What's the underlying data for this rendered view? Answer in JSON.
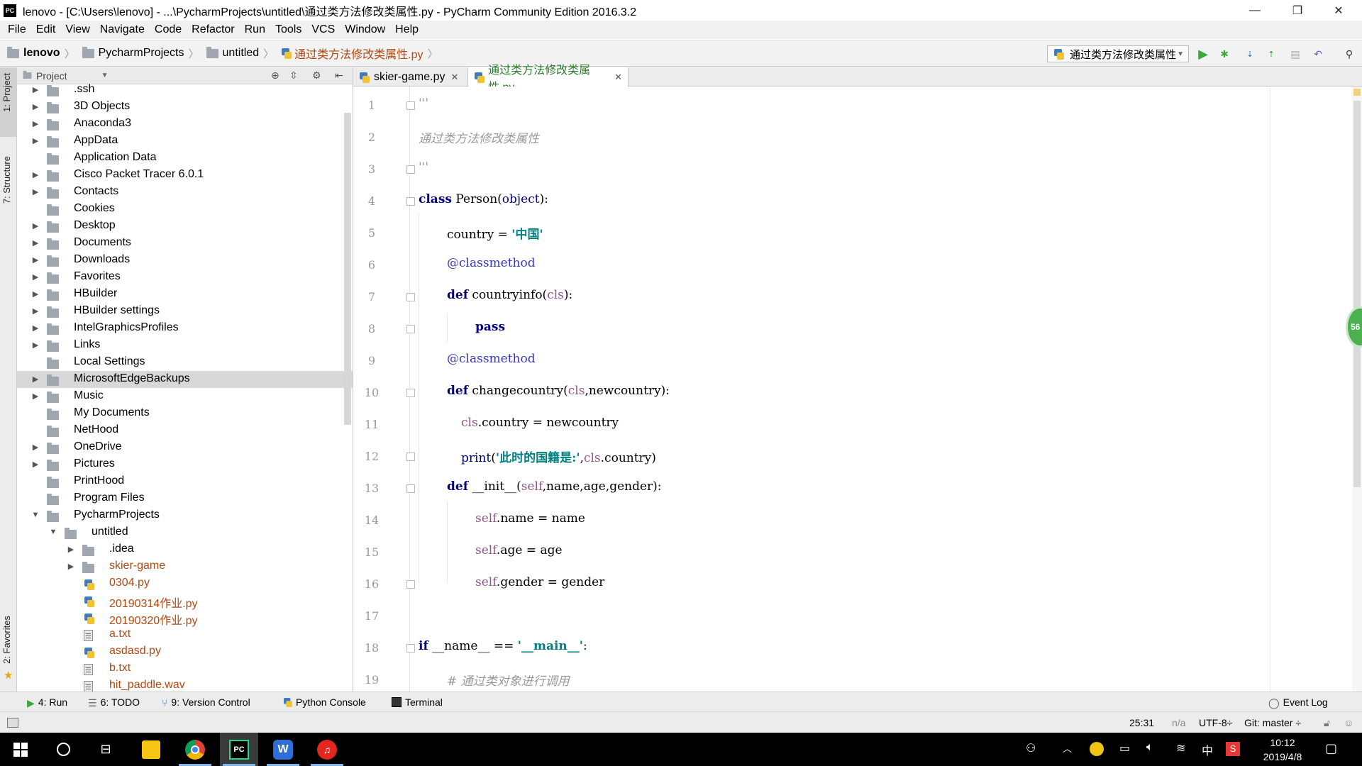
{
  "window": {
    "title": "lenovo - [C:\\Users\\lenovo] - ...\\PycharmProjects\\untitled\\通过类方法修改类属性.py - PyCharm Community Edition 2016.3.2",
    "minimize": "—",
    "restore": "❐",
    "close": "✕"
  },
  "menu": [
    "File",
    "Edit",
    "View",
    "Navigate",
    "Code",
    "Refactor",
    "Run",
    "Tools",
    "VCS",
    "Window",
    "Help"
  ],
  "breadcrumb": [
    "lenovo",
    "PycharmProjects",
    "untitled",
    "通过类方法修改类属性.py"
  ],
  "toolbar": {
    "run_config": "通过类方法修改类属性"
  },
  "project_panel": {
    "title": "Project"
  },
  "tree": [
    {
      "label": ".ssh",
      "expandable": true
    },
    {
      "label": "3D Objects",
      "expandable": true
    },
    {
      "label": "Anaconda3",
      "expandable": true
    },
    {
      "label": "AppData",
      "expandable": true
    },
    {
      "label": "Application Data",
      "expandable": false
    },
    {
      "label": "Cisco Packet Tracer 6.0.1",
      "expandable": true
    },
    {
      "label": "Contacts",
      "expandable": true
    },
    {
      "label": "Cookies",
      "expandable": false
    },
    {
      "label": "Desktop",
      "expandable": true
    },
    {
      "label": "Documents",
      "expandable": true
    },
    {
      "label": "Downloads",
      "expandable": true
    },
    {
      "label": "Favorites",
      "expandable": true
    },
    {
      "label": "HBuilder",
      "expandable": true
    },
    {
      "label": "HBuilder settings",
      "expandable": true
    },
    {
      "label": "IntelGraphicsProfiles",
      "expandable": true
    },
    {
      "label": "Links",
      "expandable": true
    },
    {
      "label": "Local Settings",
      "expandable": false
    },
    {
      "label": "MicrosoftEdgeBackups",
      "expandable": true,
      "selected": true
    },
    {
      "label": "Music",
      "expandable": true
    },
    {
      "label": "My Documents",
      "expandable": false
    },
    {
      "label": "NetHood",
      "expandable": false
    },
    {
      "label": "OneDrive",
      "expandable": true
    },
    {
      "label": "Pictures",
      "expandable": true
    },
    {
      "label": "PrintHood",
      "expandable": false
    },
    {
      "label": "Program Files",
      "expandable": false
    },
    {
      "label": "PycharmProjects",
      "expandable": true,
      "expanded": true
    },
    {
      "label": "untitled",
      "expandable": true,
      "expanded": true,
      "depth": 1
    },
    {
      "label": ".idea",
      "expandable": true,
      "depth": 2
    },
    {
      "label": "skier-game",
      "expandable": true,
      "depth": 2,
      "orange": true
    },
    {
      "label": "0304.py",
      "depth": 2,
      "file": "py",
      "orange": true
    },
    {
      "label": "20190314作业.py",
      "depth": 2,
      "file": "py",
      "orange": true
    },
    {
      "label": "20190320作业.py",
      "depth": 2,
      "file": "py",
      "orange": true
    },
    {
      "label": "a.txt",
      "depth": 2,
      "file": "txt",
      "orange": true
    },
    {
      "label": "asdasd.py",
      "depth": 2,
      "file": "py",
      "orange": true
    },
    {
      "label": "b.txt",
      "depth": 2,
      "file": "txt",
      "orange": true
    },
    {
      "label": "hit_paddle.wav",
      "depth": 2,
      "file": "txt",
      "orange": true
    }
  ],
  "tabs": [
    {
      "label": "skier-game.py",
      "active": false
    },
    {
      "label": "通过类方法修改类属性.py",
      "active": true
    }
  ],
  "code": {
    "l1": "'''",
    "l2": "通过类方法修改类属性",
    "l3": "'''",
    "l4_kw": "class",
    "l4_rest": " Person(",
    "l4_base": "object",
    "l4_end": "):",
    "l5_a": "country = ",
    "l5_s": "'中国'",
    "l6": "@classmethod",
    "l7_kw": "def",
    "l7_name": " countryinfo(",
    "l7_cls": "cls",
    "l7_end": "):",
    "l8": "pass",
    "l9": "@classmethod",
    "l10_kw": "def",
    "l10_name": " changecountry(",
    "l10_cls": "cls",
    "l10_end": ",newcountry):",
    "l11_cls": "cls",
    "l11_rest": ".country = newcountry",
    "l12_print": "print",
    "l12_open": "(",
    "l12_s": "'此时的国籍是:'",
    "l12_comma": ",",
    "l12_cls": "cls",
    "l12_end": ".country)",
    "l13_kw": "def",
    "l13_name": " __init__(",
    "l13_self": "self",
    "l13_end": ",name,age,gender):",
    "l14_self": "self",
    "l14_rest": ".name = name",
    "l15_self": "self",
    "l15_rest": ".age = age",
    "l16_self": "self",
    "l16_rest": ".gender = gender",
    "l18_kw": "if",
    "l18_rest": " __name__ == ",
    "l18_s": "'__main__'",
    "l18_end": ":",
    "l19": "# 通过类对象进行调用"
  },
  "line_numbers": [
    "1",
    "2",
    "3",
    "4",
    "5",
    "6",
    "7",
    "8",
    "9",
    "10",
    "11",
    "12",
    "13",
    "14",
    "15",
    "16",
    "17",
    "18",
    "19"
  ],
  "badge": "56",
  "side_tabs": {
    "project": "1: Project",
    "structure": "7: Structure",
    "favorites": "2: Favorites"
  },
  "tool_windows": {
    "run": "4: Run",
    "todo": "6: TODO",
    "vcs": "9: Version Control",
    "console": "Python Console",
    "terminal": "Terminal",
    "event_log": "Event Log"
  },
  "status": {
    "position": "25:31",
    "na": "n/a",
    "encoding": "UTF-8÷",
    "git": "Git: master ÷"
  },
  "taskbar": {
    "time": "10:12",
    "date": "2019/4/8",
    "ime": "中"
  },
  "colors": {
    "keyword": "#000080",
    "string": "#008080",
    "self": "#94558d",
    "selection": "#d8d8d8"
  }
}
